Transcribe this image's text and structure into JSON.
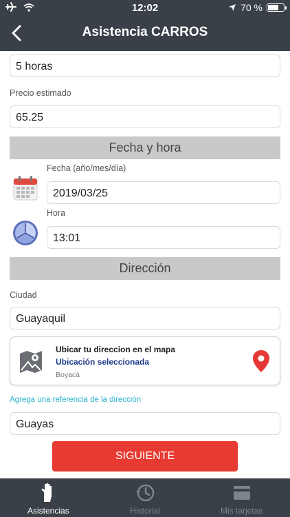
{
  "status_bar": {
    "time": "12:02",
    "battery": "70 %",
    "battery_level": 0.7
  },
  "header": {
    "title": "Asistencia CARROS"
  },
  "form": {
    "duration_value": "5 horas",
    "price_label": "Precio estimado",
    "price_value": "65.25",
    "section_datetime": "Fecha y hora",
    "date_label": "Fecha (año/mes/día)",
    "date_value": "2019/03/25",
    "time_label": "Hora",
    "time_value": "13:01",
    "section_address": "Dirección",
    "city_label": "Ciudad",
    "city_value": "Guayaquil",
    "map_card": {
      "title": "Ubicar tu direccion en el mapa",
      "selected": "Ubicación seleccionada",
      "place": "Boyacá"
    },
    "reference_label": "Agrega una referencia de la dirección",
    "reference_value": "Guayas",
    "next_button": "SIGUIENTE"
  },
  "tabbar": {
    "tabs": [
      {
        "label": "Asistencias",
        "icon": "hand-icon",
        "active": true
      },
      {
        "label": "Historial",
        "icon": "history-icon",
        "active": false
      },
      {
        "label": "Mis tarjetas",
        "icon": "card-icon",
        "active": false
      }
    ]
  },
  "colors": {
    "header": "#3a4047",
    "accent_red": "#e63a32",
    "link_cyan": "#2bb3c9",
    "section_gray": "#c9c9c9"
  }
}
